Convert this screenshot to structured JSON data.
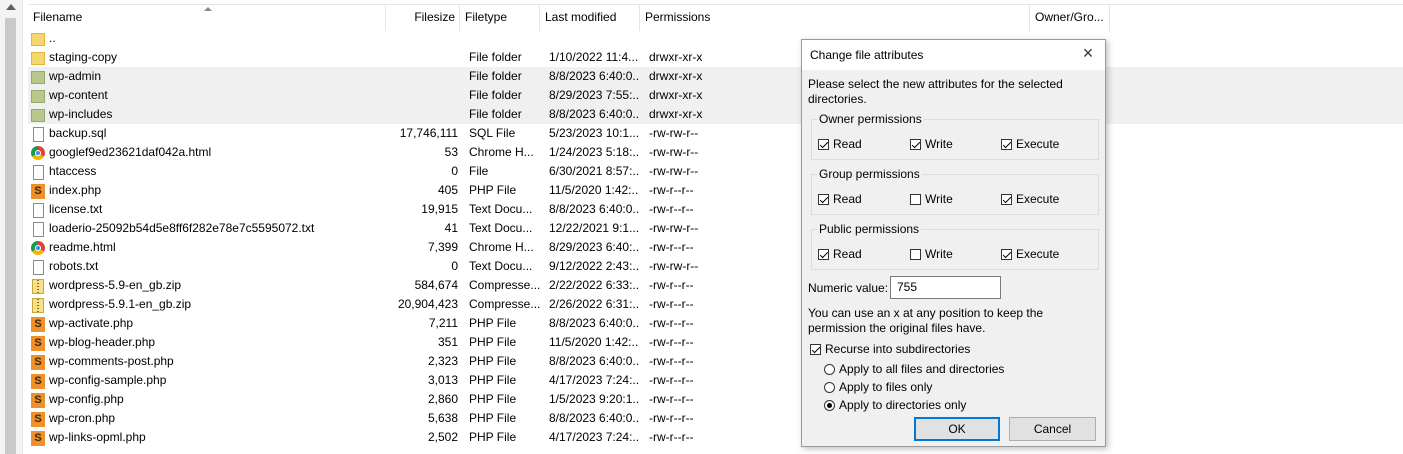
{
  "columns": {
    "filename": "Filename",
    "filesize": "Filesize",
    "filetype": "Filetype",
    "modified": "Last modified",
    "permissions": "Permissions",
    "owner": "Owner/Gro..."
  },
  "rows": [
    {
      "name": "..",
      "size": "",
      "type": "",
      "modified": "",
      "perm": "",
      "icon": "folder-icon",
      "selected": false
    },
    {
      "name": "staging-copy",
      "size": "",
      "type": "File folder",
      "modified": "1/10/2022 11:4...",
      "perm": "drwxr-xr-x",
      "icon": "folder-icon",
      "selected": false
    },
    {
      "name": "wp-admin",
      "size": "",
      "type": "File folder",
      "modified": "8/8/2023 6:40:0...",
      "perm": "drwxr-xr-x",
      "icon": "folder-icon",
      "selected": true
    },
    {
      "name": "wp-content",
      "size": "",
      "type": "File folder",
      "modified": "8/29/2023 7:55:...",
      "perm": "drwxr-xr-x",
      "icon": "folder-icon",
      "selected": true
    },
    {
      "name": "wp-includes",
      "size": "",
      "type": "File folder",
      "modified": "8/8/2023 6:40:0...",
      "perm": "drwxr-xr-x",
      "icon": "folder-icon",
      "selected": true
    },
    {
      "name": "backup.sql",
      "size": "17,746,111",
      "type": "SQL File",
      "modified": "5/23/2023 10:1...",
      "perm": "-rw-rw-r--",
      "icon": "file-icon",
      "selected": false
    },
    {
      "name": "googlef9ed23621daf042a.html",
      "size": "53",
      "type": "Chrome H...",
      "modified": "1/24/2023 5:18:...",
      "perm": "-rw-rw-r--",
      "icon": "chrome-icon",
      "selected": false
    },
    {
      "name": "htaccess",
      "size": "0",
      "type": "File",
      "modified": "6/30/2021 8:57:...",
      "perm": "-rw-rw-r--",
      "icon": "file-icon",
      "selected": false
    },
    {
      "name": "index.php",
      "size": "405",
      "type": "PHP File",
      "modified": "11/5/2020 1:42:...",
      "perm": "-rw-r--r--",
      "icon": "php-icon",
      "selected": false
    },
    {
      "name": "license.txt",
      "size": "19,915",
      "type": "Text Docu...",
      "modified": "8/8/2023 6:40:0...",
      "perm": "-rw-r--r--",
      "icon": "file-icon",
      "selected": false
    },
    {
      "name": "loaderio-25092b54d5e8ff6f282e78e7c5595072.txt",
      "size": "41",
      "type": "Text Docu...",
      "modified": "12/22/2021 9:1...",
      "perm": "-rw-rw-r--",
      "icon": "file-icon",
      "selected": false
    },
    {
      "name": "readme.html",
      "size": "7,399",
      "type": "Chrome H...",
      "modified": "8/29/2023 6:40:...",
      "perm": "-rw-r--r--",
      "icon": "chrome-icon",
      "selected": false
    },
    {
      "name": "robots.txt",
      "size": "0",
      "type": "Text Docu...",
      "modified": "9/12/2022 2:43:...",
      "perm": "-rw-rw-r--",
      "icon": "file-icon",
      "selected": false
    },
    {
      "name": "wordpress-5.9-en_gb.zip",
      "size": "584,674",
      "type": "Compresse...",
      "modified": "2/22/2022 6:33:...",
      "perm": "-rw-r--r--",
      "icon": "zip-icon",
      "selected": false
    },
    {
      "name": "wordpress-5.9.1-en_gb.zip",
      "size": "20,904,423",
      "type": "Compresse...",
      "modified": "2/26/2022 6:31:...",
      "perm": "-rw-r--r--",
      "icon": "zip-icon",
      "selected": false
    },
    {
      "name": "wp-activate.php",
      "size": "7,211",
      "type": "PHP File",
      "modified": "8/8/2023 6:40:0...",
      "perm": "-rw-r--r--",
      "icon": "php-icon",
      "selected": false
    },
    {
      "name": "wp-blog-header.php",
      "size": "351",
      "type": "PHP File",
      "modified": "11/5/2020 1:42:...",
      "perm": "-rw-r--r--",
      "icon": "php-icon",
      "selected": false
    },
    {
      "name": "wp-comments-post.php",
      "size": "2,323",
      "type": "PHP File",
      "modified": "8/8/2023 6:40:0...",
      "perm": "-rw-r--r--",
      "icon": "php-icon",
      "selected": false
    },
    {
      "name": "wp-config-sample.php",
      "size": "3,013",
      "type": "PHP File",
      "modified": "4/17/2023 7:24:...",
      "perm": "-rw-r--r--",
      "icon": "php-icon",
      "selected": false
    },
    {
      "name": "wp-config.php",
      "size": "2,860",
      "type": "PHP File",
      "modified": "1/5/2023 9:20:1...",
      "perm": "-rw-r--r--",
      "icon": "php-icon",
      "selected": false
    },
    {
      "name": "wp-cron.php",
      "size": "5,638",
      "type": "PHP File",
      "modified": "8/8/2023 6:40:0...",
      "perm": "-rw-r--r--",
      "icon": "php-icon",
      "selected": false
    },
    {
      "name": "wp-links-opml.php",
      "size": "2,502",
      "type": "PHP File",
      "modified": "4/17/2023 7:24:...",
      "perm": "-rw-r--r--",
      "icon": "php-icon",
      "selected": false
    }
  ],
  "dialog": {
    "title": "Change file attributes",
    "close_glyph": "×",
    "description": "Please select the new attributes for the selected directories.",
    "groups": [
      {
        "label": "Owner permissions",
        "read": true,
        "write": true,
        "execute": true
      },
      {
        "label": "Group permissions",
        "read": true,
        "write": false,
        "execute": true
      },
      {
        "label": "Public permissions",
        "read": true,
        "write": false,
        "execute": true
      }
    ],
    "read_label": "Read",
    "write_label": "Write",
    "execute_label": "Execute",
    "numeric_label": "Numeric value:",
    "numeric_value": "755",
    "hint": "You can use an x at any position to keep the permission the original files have.",
    "recurse_label": "Recurse into subdirectories",
    "recurse_checked": true,
    "radio_options": [
      {
        "label": "Apply to all files and directories",
        "selected": false
      },
      {
        "label": "Apply to files only",
        "selected": false
      },
      {
        "label": "Apply to directories only",
        "selected": true
      }
    ],
    "ok_label": "OK",
    "cancel_label": "Cancel"
  }
}
